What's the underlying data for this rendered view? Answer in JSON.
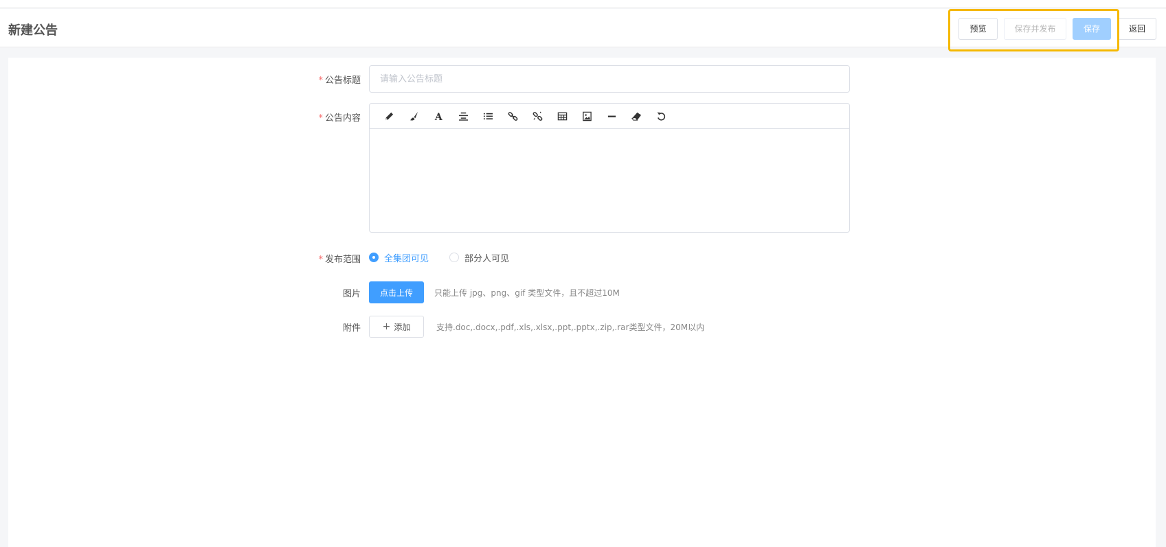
{
  "header": {
    "title": "新建公告",
    "buttons": {
      "preview": "预览",
      "save_publish": "保存并发布",
      "save": "保存",
      "back": "返回"
    }
  },
  "form": {
    "required_mark": "*",
    "title_label": "公告标题",
    "title_placeholder": "请输入公告标题",
    "title_value": "",
    "content_label": "公告内容",
    "toolbar_icons": [
      "pencil-icon",
      "brush-icon",
      "font-icon",
      "align-center-icon",
      "list-icon",
      "link-icon",
      "unlink-icon",
      "table-icon",
      "image-icon",
      "horizontal-rule-icon",
      "eraser-icon",
      "undo-icon"
    ],
    "scope_label": "发布范围",
    "scope_options": [
      "全集团可见",
      "部分人可见"
    ],
    "scope_selected": "全集团可见",
    "image_label": "图片",
    "image_upload_label": "点击上传",
    "image_hint": "只能上传 jpg、png、gif 类型文件，且不超过10M",
    "attach_label": "附件",
    "attach_add_label": "添加",
    "attach_hint": "支持.doc,.docx,.pdf,.xls,.xlsx,.ppt,.pptx,.zip,.rar类型文件，20M以内"
  },
  "colors": {
    "primary": "#409eff",
    "primary_light": "#a0cfff",
    "required": "#f56c6c",
    "highlight": "#f5b800"
  }
}
